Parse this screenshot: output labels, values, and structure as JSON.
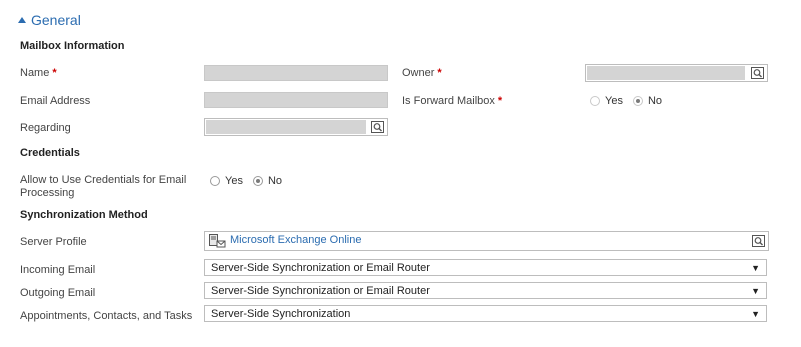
{
  "section": {
    "title": "General"
  },
  "mailbox": {
    "heading": "Mailbox Information",
    "name_label": "Name",
    "email_label": "Email Address",
    "regarding_label": "Regarding",
    "owner_label": "Owner",
    "forward_label": "Is Forward Mailbox",
    "forward_options": {
      "yes": "Yes",
      "no": "No"
    },
    "required_mark": "*"
  },
  "credentials": {
    "heading": "Credentials",
    "allow_label_line1": "Allow to Use Credentials for Email",
    "allow_label_line2": "Processing",
    "options": {
      "yes": "Yes",
      "no": "No"
    }
  },
  "sync": {
    "heading": "Synchronization Method",
    "server_profile_label": "Server Profile",
    "server_profile_value": "Microsoft Exchange Online",
    "incoming_label": "Incoming Email",
    "incoming_value": "Server-Side Synchronization or Email Router",
    "outgoing_label": "Outgoing Email",
    "outgoing_value": "Server-Side Synchronization or Email Router",
    "appointments_label": "Appointments, Contacts, and Tasks",
    "appointments_value": "Server-Side Synchronization"
  },
  "icons": {
    "lookup": "lookup-search-icon",
    "collapse": "collapse-caret-icon",
    "server": "server-profile-icon",
    "dropdown": "dropdown-arrow-icon"
  }
}
